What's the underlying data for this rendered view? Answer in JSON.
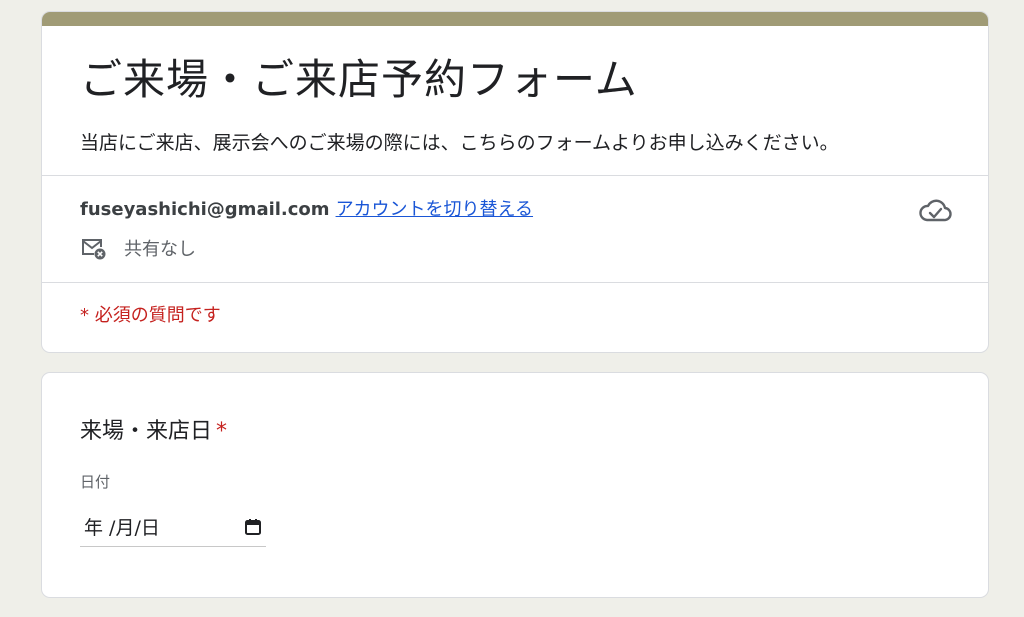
{
  "header": {
    "title": "ご来場・ご来店予約フォーム",
    "description": "当店にご来店、展示会へのご来場の際には、こちらのフォームよりお申し込みください。"
  },
  "account": {
    "email": "fuseyashichi@gmail.com",
    "switch_label": "アカウントを切り替える",
    "share_status": "共有なし"
  },
  "required_note": "* 必須の質問です",
  "question": {
    "title": "来場・来店日",
    "required_marker": "*",
    "date_label": "日付",
    "date_placeholder": "年 /月/日"
  },
  "colors": {
    "accent_band": "#a09b76",
    "link": "#1a56d6",
    "required": "#c5221f",
    "background": "#efefe9"
  },
  "icons": {
    "share": "mail-blocked-icon",
    "save": "cloud-check-icon",
    "date": "calendar-icon"
  }
}
